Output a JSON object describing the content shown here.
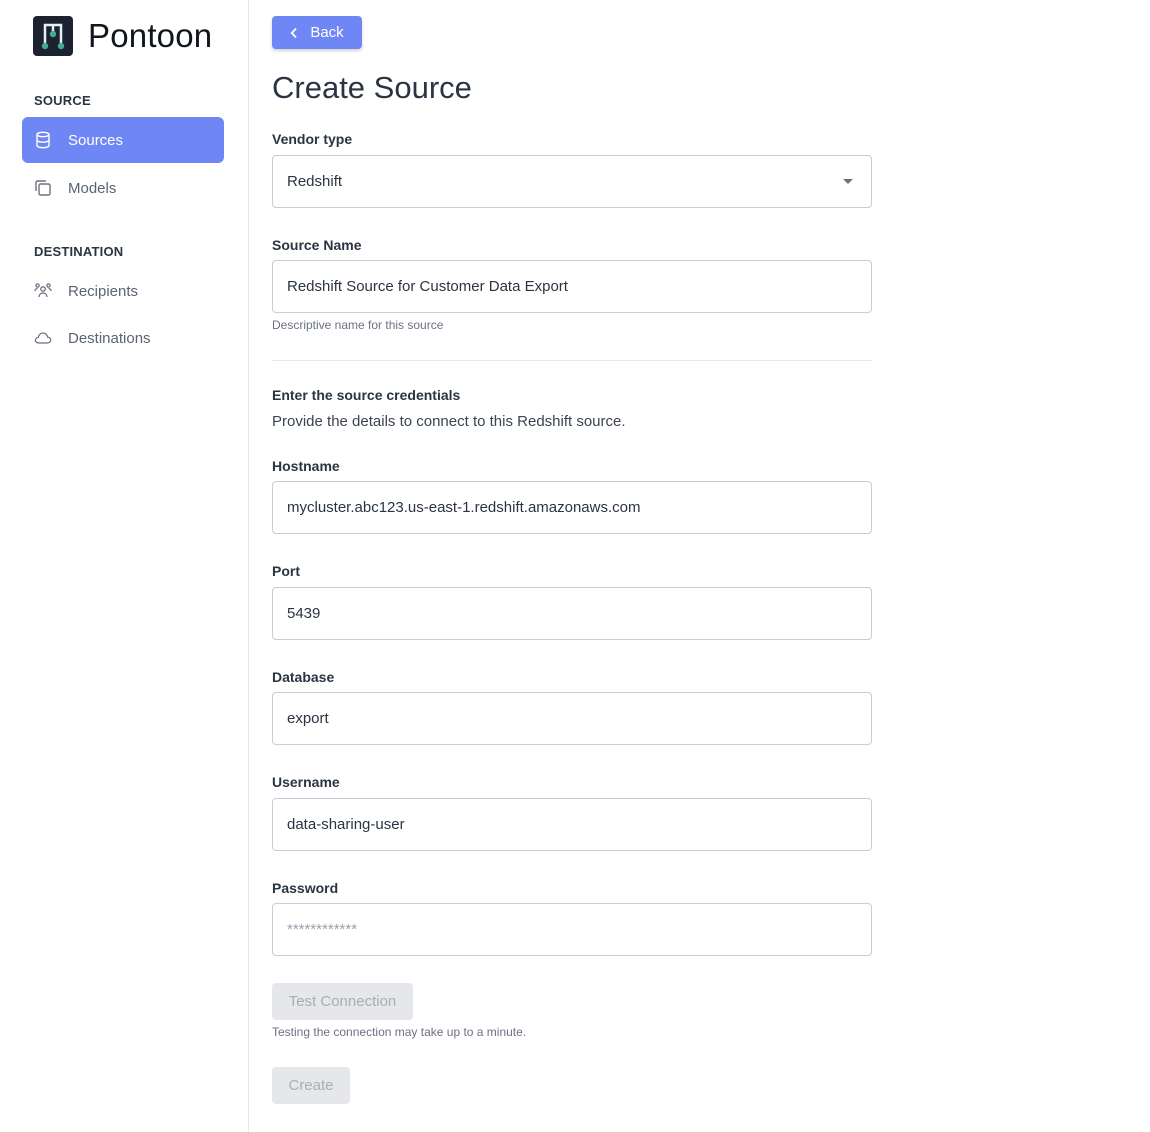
{
  "app": {
    "name": "Pontoon"
  },
  "sidebar": {
    "source_section": "SOURCE",
    "destination_section": "DESTINATION",
    "items": [
      {
        "label": "Sources",
        "icon": "database-icon",
        "active": true
      },
      {
        "label": "Models",
        "icon": "copy-icon",
        "active": false
      },
      {
        "label": "Recipients",
        "icon": "users-icon",
        "active": false
      },
      {
        "label": "Destinations",
        "icon": "cloud-icon",
        "active": false
      }
    ]
  },
  "header": {
    "back_label": "Back",
    "title": "Create Source"
  },
  "form": {
    "vendor_type": {
      "label": "Vendor type",
      "value": "Redshift"
    },
    "source_name": {
      "label": "Source Name",
      "value": "Redshift Source for Customer Data Export",
      "helper": "Descriptive name for this source"
    },
    "credentials": {
      "heading": "Enter the source credentials",
      "description": "Provide the details to connect to this Redshift source."
    },
    "hostname": {
      "label": "Hostname",
      "value": "mycluster.abc123.us-east-1.redshift.amazonaws.com"
    },
    "port": {
      "label": "Port",
      "value": "5439"
    },
    "database": {
      "label": "Database",
      "value": "export"
    },
    "username": {
      "label": "Username",
      "value": "data-sharing-user"
    },
    "password": {
      "label": "Password",
      "placeholder": "************"
    },
    "test_connection_label": "Test Connection",
    "test_connection_helper": "Testing the connection may take up to a minute.",
    "create_label": "Create"
  },
  "colors": {
    "accent": "#6f87f5",
    "disabled_bg": "#e6e7ea",
    "disabled_text": "#a9adb5"
  }
}
